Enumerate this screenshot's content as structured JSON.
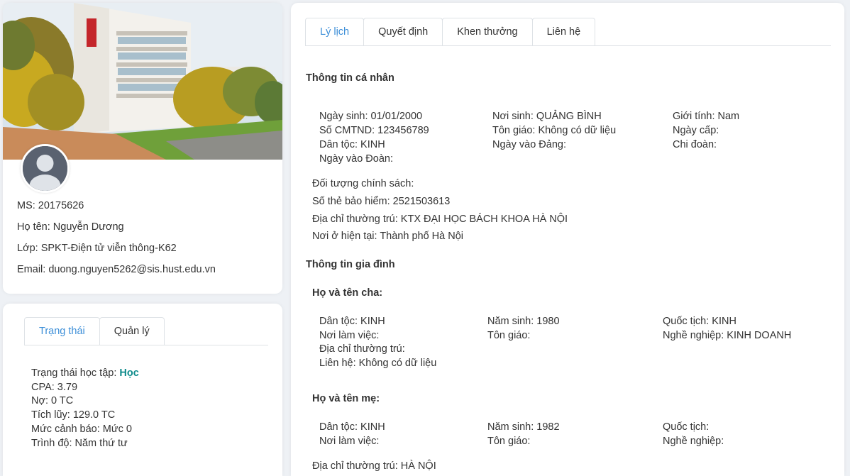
{
  "profile": {
    "ms": "MS: 20175626",
    "name": "Họ tên: Nguyễn Dương",
    "class": "Lớp: SPKT-Điện tử viễn thông-K62",
    "email": "Email: duong.nguyen5262@sis.hust.edu.vn"
  },
  "status_card": {
    "tabs": [
      "Trạng thái",
      "Quản lý"
    ],
    "status_label": "Trạng thái học tập: ",
    "status_value": "Học",
    "cpa": "CPA: 3.79",
    "debt": "Nợ: 0 TC",
    "accumulated": "Tích lũy: 129.0 TC",
    "warning": "Mức cảnh báo: Mức 0",
    "level": "Trình độ: Năm thứ tư"
  },
  "main": {
    "tabs": [
      "Lý lịch",
      "Quyết định",
      "Khen thưởng",
      "Liên hệ"
    ],
    "personal": {
      "heading": "Thông tin cá nhân",
      "dob": "Ngày sinh: 01/01/2000",
      "id_no": "Số CMTND: 123456789",
      "ethnicity": "Dân tộc: KINH",
      "union_date": "Ngày vào Đoàn:",
      "birthplace": "Nơi sinh: QUẢNG BÌNH",
      "religion": "Tôn giáo: Không có dữ liệu",
      "party_date": "Ngày vào Đảng:",
      "gender": "Giới tính: Nam",
      "issue_date": "Ngày cấp:",
      "branch": "Chi đoàn:",
      "policy": "Đối tượng chính sách:",
      "insurance": "Số thẻ bảo hiểm: 2521503613",
      "address": "Địa chỉ thường trú: KTX ĐẠI HỌC BÁCH KHOA HÀ NỘI",
      "current": "Nơi ở hiện tại: Thành phố Hà Nội"
    },
    "family": {
      "heading": "Thông tin gia đình",
      "father": {
        "heading": "Họ và tên cha:",
        "ethnicity": "Dân tộc: KINH",
        "workplace": "Nơi làm việc:",
        "address": "Địa chỉ thường trú:",
        "contact": "Liên hệ: Không có dữ liệu",
        "birth_year": "Năm sinh: 1980",
        "religion": "Tôn giáo:",
        "nationality": "Quốc tịch: KINH",
        "job": "Nghề nghiệp: KINH DOANH"
      },
      "mother": {
        "heading": "Họ và tên mẹ:",
        "ethnicity": "Dân tộc: KINH",
        "workplace": "Nơi làm việc:",
        "birth_year": "Năm sinh: 1982",
        "religion": "Tôn giáo:",
        "nationality": "Quốc tịch:",
        "job": "Nghề nghiệp:",
        "address": "Địa chỉ thường trú: HÀ NỘI"
      }
    }
  },
  "colors": {
    "accent": "#3d8fd8",
    "status": "#0d8b8b"
  },
  "icons": {
    "avatar": "user-silhouette-icon"
  }
}
